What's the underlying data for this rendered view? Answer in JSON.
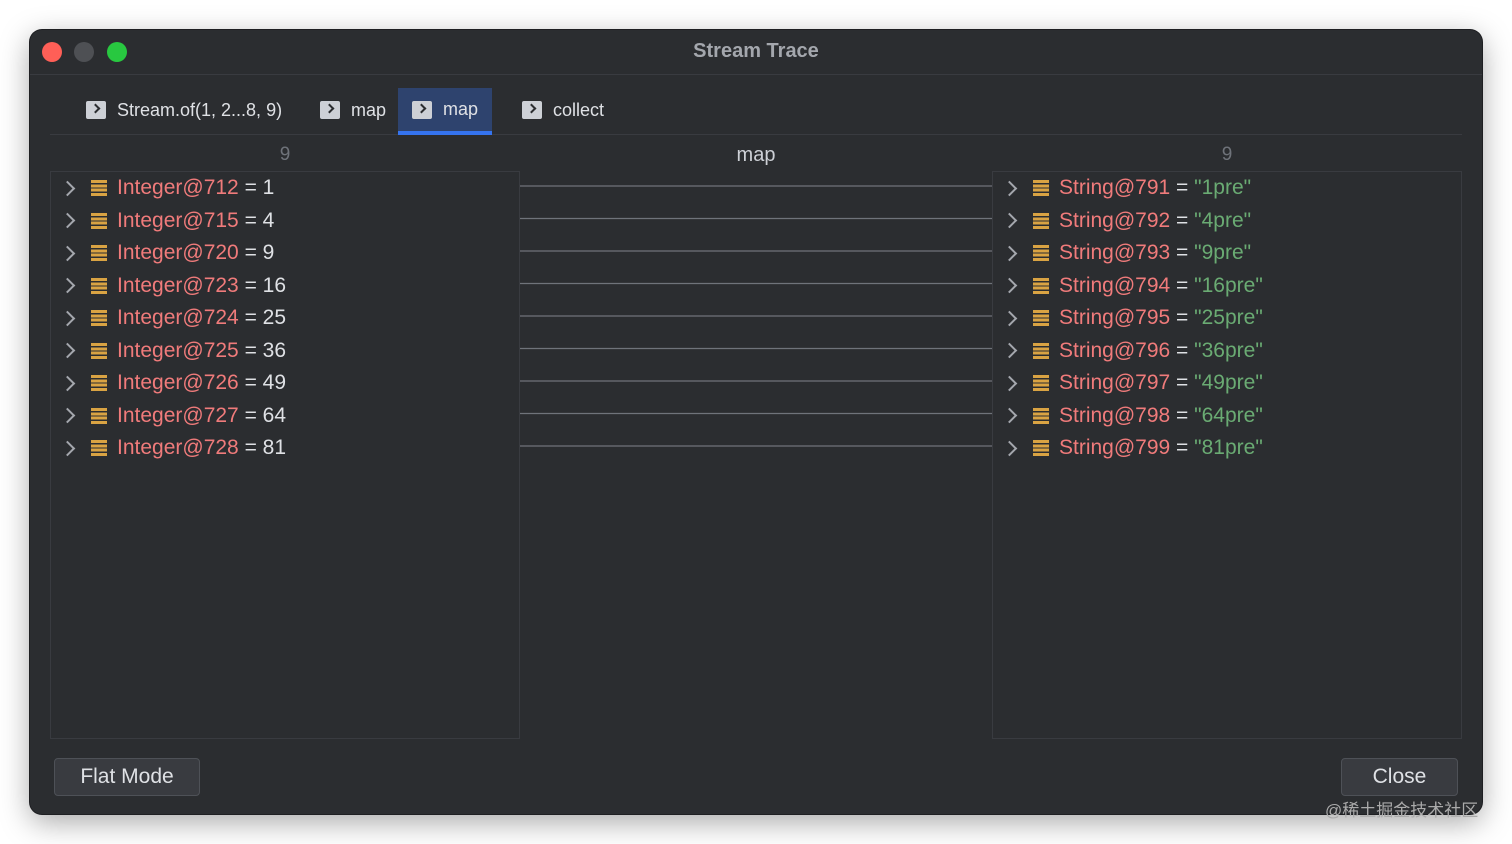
{
  "window": {
    "title": "Stream Trace"
  },
  "tabs": [
    {
      "label": "Stream.of(1, 2...8, 9)"
    },
    {
      "label": "map"
    },
    {
      "label": "map"
    },
    {
      "label": "collect"
    }
  ],
  "active_tab_index": 2,
  "columns": {
    "left_count": "9",
    "middle_label": "map",
    "right_count": "9"
  },
  "left_items": [
    {
      "name": "Integer@712",
      "eq": " = ",
      "value": "1"
    },
    {
      "name": "Integer@715",
      "eq": " = ",
      "value": "4"
    },
    {
      "name": "Integer@720",
      "eq": " = ",
      "value": "9"
    },
    {
      "name": "Integer@723",
      "eq": " = ",
      "value": "16"
    },
    {
      "name": "Integer@724",
      "eq": " = ",
      "value": "25"
    },
    {
      "name": "Integer@725",
      "eq": " = ",
      "value": "36"
    },
    {
      "name": "Integer@726",
      "eq": " = ",
      "value": "49"
    },
    {
      "name": "Integer@727",
      "eq": " = ",
      "value": "64"
    },
    {
      "name": "Integer@728",
      "eq": " = ",
      "value": "81"
    }
  ],
  "right_items": [
    {
      "name": "String@791",
      "eq": " = ",
      "value": "\"1pre\""
    },
    {
      "name": "String@792",
      "eq": " = ",
      "value": "\"4pre\""
    },
    {
      "name": "String@793",
      "eq": " = ",
      "value": "\"9pre\""
    },
    {
      "name": "String@794",
      "eq": " = ",
      "value": "\"16pre\""
    },
    {
      "name": "String@795",
      "eq": " = ",
      "value": "\"25pre\""
    },
    {
      "name": "String@796",
      "eq": " = ",
      "value": "\"36pre\""
    },
    {
      "name": "String@797",
      "eq": " = ",
      "value": "\"49pre\""
    },
    {
      "name": "String@798",
      "eq": " = ",
      "value": "\"64pre\""
    },
    {
      "name": "String@799",
      "eq": " = ",
      "value": "\"81pre\""
    }
  ],
  "buttons": {
    "flat_mode": "Flat Mode",
    "close": "Close"
  },
  "watermark": "@稀土掘金技术社区",
  "colors": {
    "window_bg": "#2b2d30",
    "name_red": "#f07b7b",
    "string_green": "#6aab73",
    "field_icon": "#d9a343",
    "active_tab_underline": "#3574f0"
  },
  "icons": {
    "tab": "play-step-icon",
    "row_expand": "chevron-right-icon",
    "row_field": "field-icon"
  }
}
